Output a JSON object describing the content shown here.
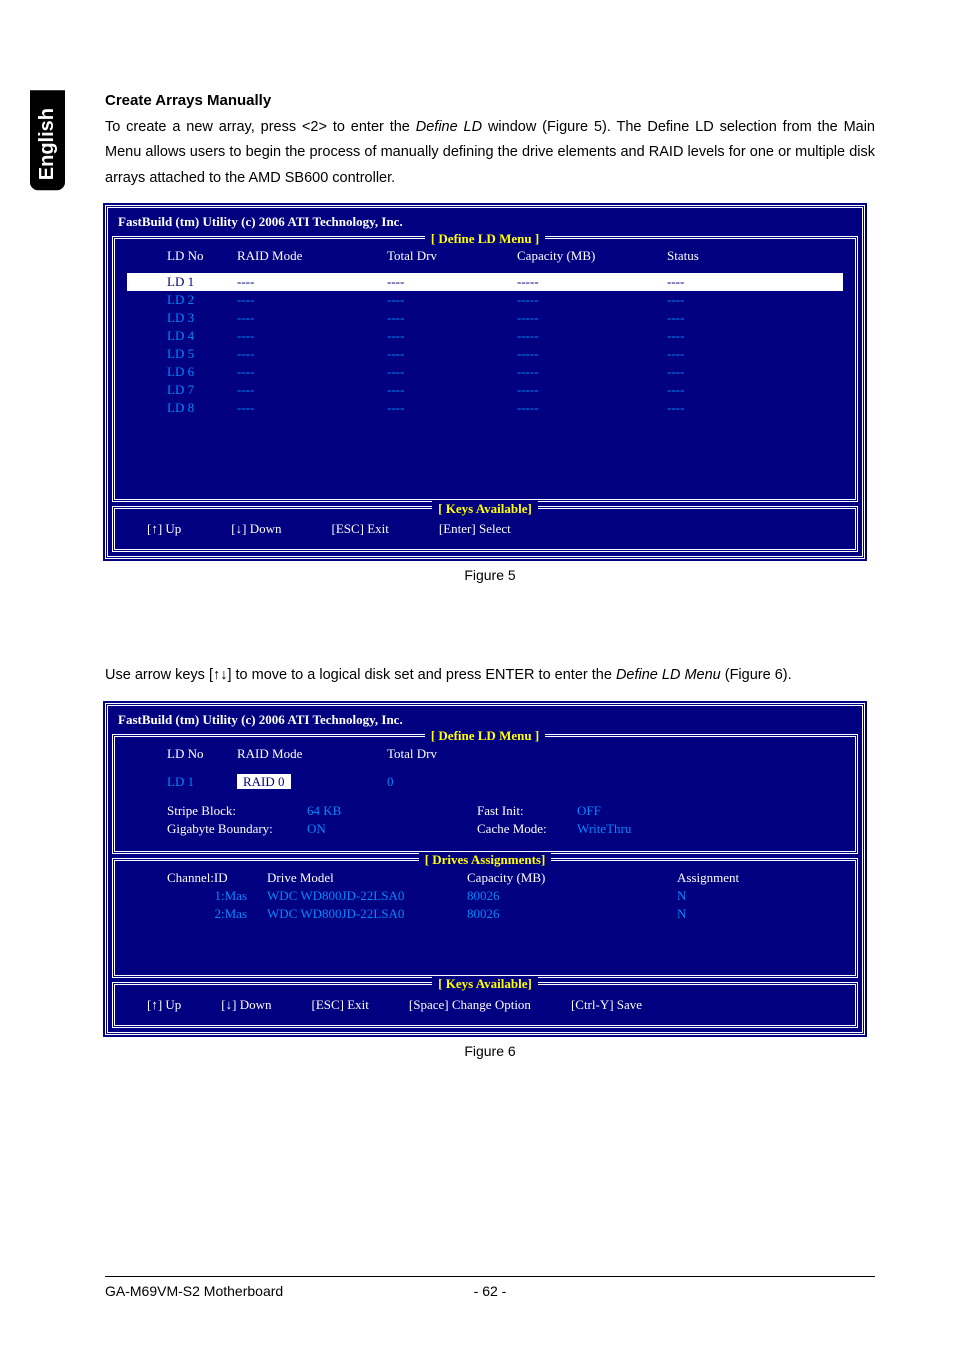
{
  "lang_tab": "English",
  "section_title": "Create Arrays Manually",
  "intro_p1a": "To create a new array, press <2> to enter the ",
  "intro_p1_italic": "Define LD",
  "intro_p1b": " window (Figure 5). The Define LD selection from the Main Menu allows users to begin the process of manually defining the drive elements and RAID levels for one or multiple disk arrays attached to the AMD SB600 controller.",
  "fig5": {
    "utility_title": "FastBuild (tm) Utility (c) 2006 ATI Technology, Inc.",
    "panel_label": "[  Define LD Menu  ]",
    "headers": {
      "ldno": "LD No",
      "raid": "RAID Mode",
      "drv": "Total Drv",
      "cap": "Capacity (MB)",
      "status": "Status"
    },
    "rows": [
      {
        "ld": "LD  1",
        "raid": "----",
        "drv": "----",
        "cap": "-----",
        "status": "----",
        "selected": true
      },
      {
        "ld": "LD  2",
        "raid": "----",
        "drv": "----",
        "cap": "-----",
        "status": "----"
      },
      {
        "ld": "LD  3",
        "raid": "----",
        "drv": "----",
        "cap": "-----",
        "status": "----"
      },
      {
        "ld": "LD  4",
        "raid": "----",
        "drv": "----",
        "cap": "-----",
        "status": "----"
      },
      {
        "ld": "LD  5",
        "raid": "----",
        "drv": "----",
        "cap": "-----",
        "status": "----"
      },
      {
        "ld": "LD  6",
        "raid": "----",
        "drv": "----",
        "cap": "-----",
        "status": "----"
      },
      {
        "ld": "LD  7",
        "raid": "----",
        "drv": "----",
        "cap": "-----",
        "status": "----"
      },
      {
        "ld": "LD  8",
        "raid": "----",
        "drv": "----",
        "cap": "-----",
        "status": "----"
      }
    ],
    "keys_label": "[  Keys Available]",
    "keys": {
      "up": "[↑] Up",
      "down": "[↓] Down",
      "esc": "[ESC] Exit",
      "enter": "[Enter] Select"
    },
    "caption": "Figure 5"
  },
  "mid_p_a": "Use arrow keys [↑↓] to move to a logical disk set and press ENTER to enter the ",
  "mid_p_italic": "Define LD Menu",
  "mid_p_b": " (Figure 6).",
  "fig6": {
    "utility_title": "FastBuild (tm) Utility (c) 2006 ATI Technology, Inc.",
    "panel_label": "[  Define LD Menu  ]",
    "headers": {
      "ldno": "LD No",
      "raid": "RAID Mode",
      "drv": "Total Drv"
    },
    "row": {
      "ld": "LD  1",
      "raid": "RAID 0",
      "drv": "0"
    },
    "opts": {
      "stripe_label": "Stripe Block:",
      "stripe_val": "64  KB",
      "gb_label": "Gigabyte Boundary:",
      "gb_val": "ON",
      "fast_label": "Fast Init:",
      "fast_val": "OFF",
      "cache_label": "Cache Mode:",
      "cache_val": "WriteThru"
    },
    "drives_label": "[  Drives Assignments]",
    "drive_headers": {
      "ch": "Channel:ID",
      "model": "Drive Model",
      "cap": "Capacity (MB)",
      "asg": "Assignment"
    },
    "drives": [
      {
        "ch": "1:Mas",
        "model": "WDC WD800JD-22LSA0",
        "cap": "80026",
        "asg": "N"
      },
      {
        "ch": "2:Mas",
        "model": "WDC WD800JD-22LSA0",
        "cap": "80026",
        "asg": "N"
      }
    ],
    "keys_label": "[  Keys Available]",
    "keys": {
      "up": "[↑] Up",
      "down": "[↓] Down",
      "esc": "[ESC] Exit",
      "space": "[Space] Change Option",
      "save": "[Ctrl-Y] Save"
    },
    "caption": "Figure 6"
  },
  "footer": {
    "product": "GA-M69VM-S2 Motherboard",
    "page": "- 62 -"
  }
}
